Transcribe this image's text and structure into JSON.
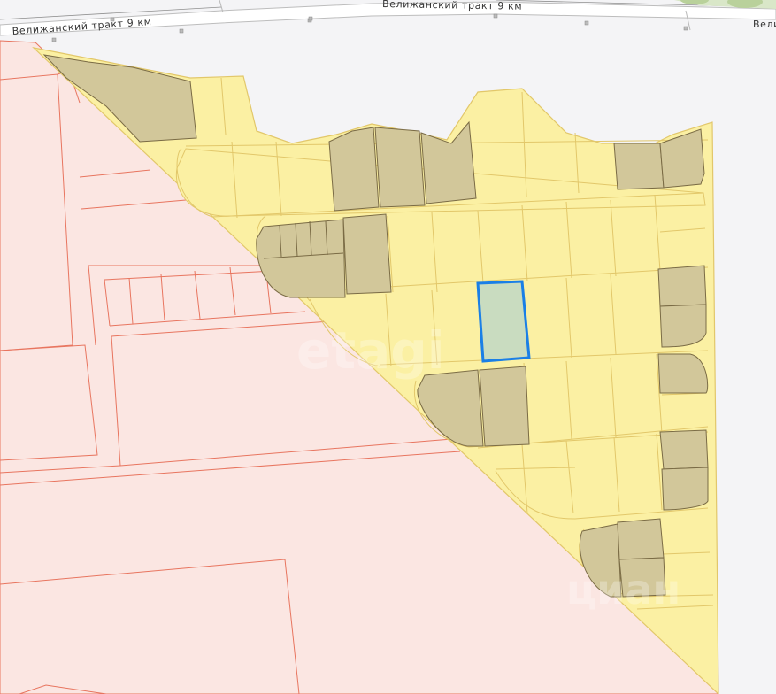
{
  "map": {
    "road_label_left": "Велижанский тракт 9 км",
    "road_label_center": "Велижанский тракт 9 км",
    "road_label_right": "Велиж",
    "watermark_center": "etagi",
    "watermark_corner": "циан"
  },
  "colors": {
    "background": "#f4f4f6",
    "residential_zone": "#fbe6e2",
    "residential_border": "#e8755f",
    "plot_fill": "#fbf0a3",
    "plot_border": "#e2c76a",
    "plot_built": "#d2c79a",
    "plot_built_border": "#7a6b45",
    "selected_plot_fill": "#c9dcc0",
    "selected_plot_border": "#1a7fe6",
    "road": "#c9c9c9"
  }
}
